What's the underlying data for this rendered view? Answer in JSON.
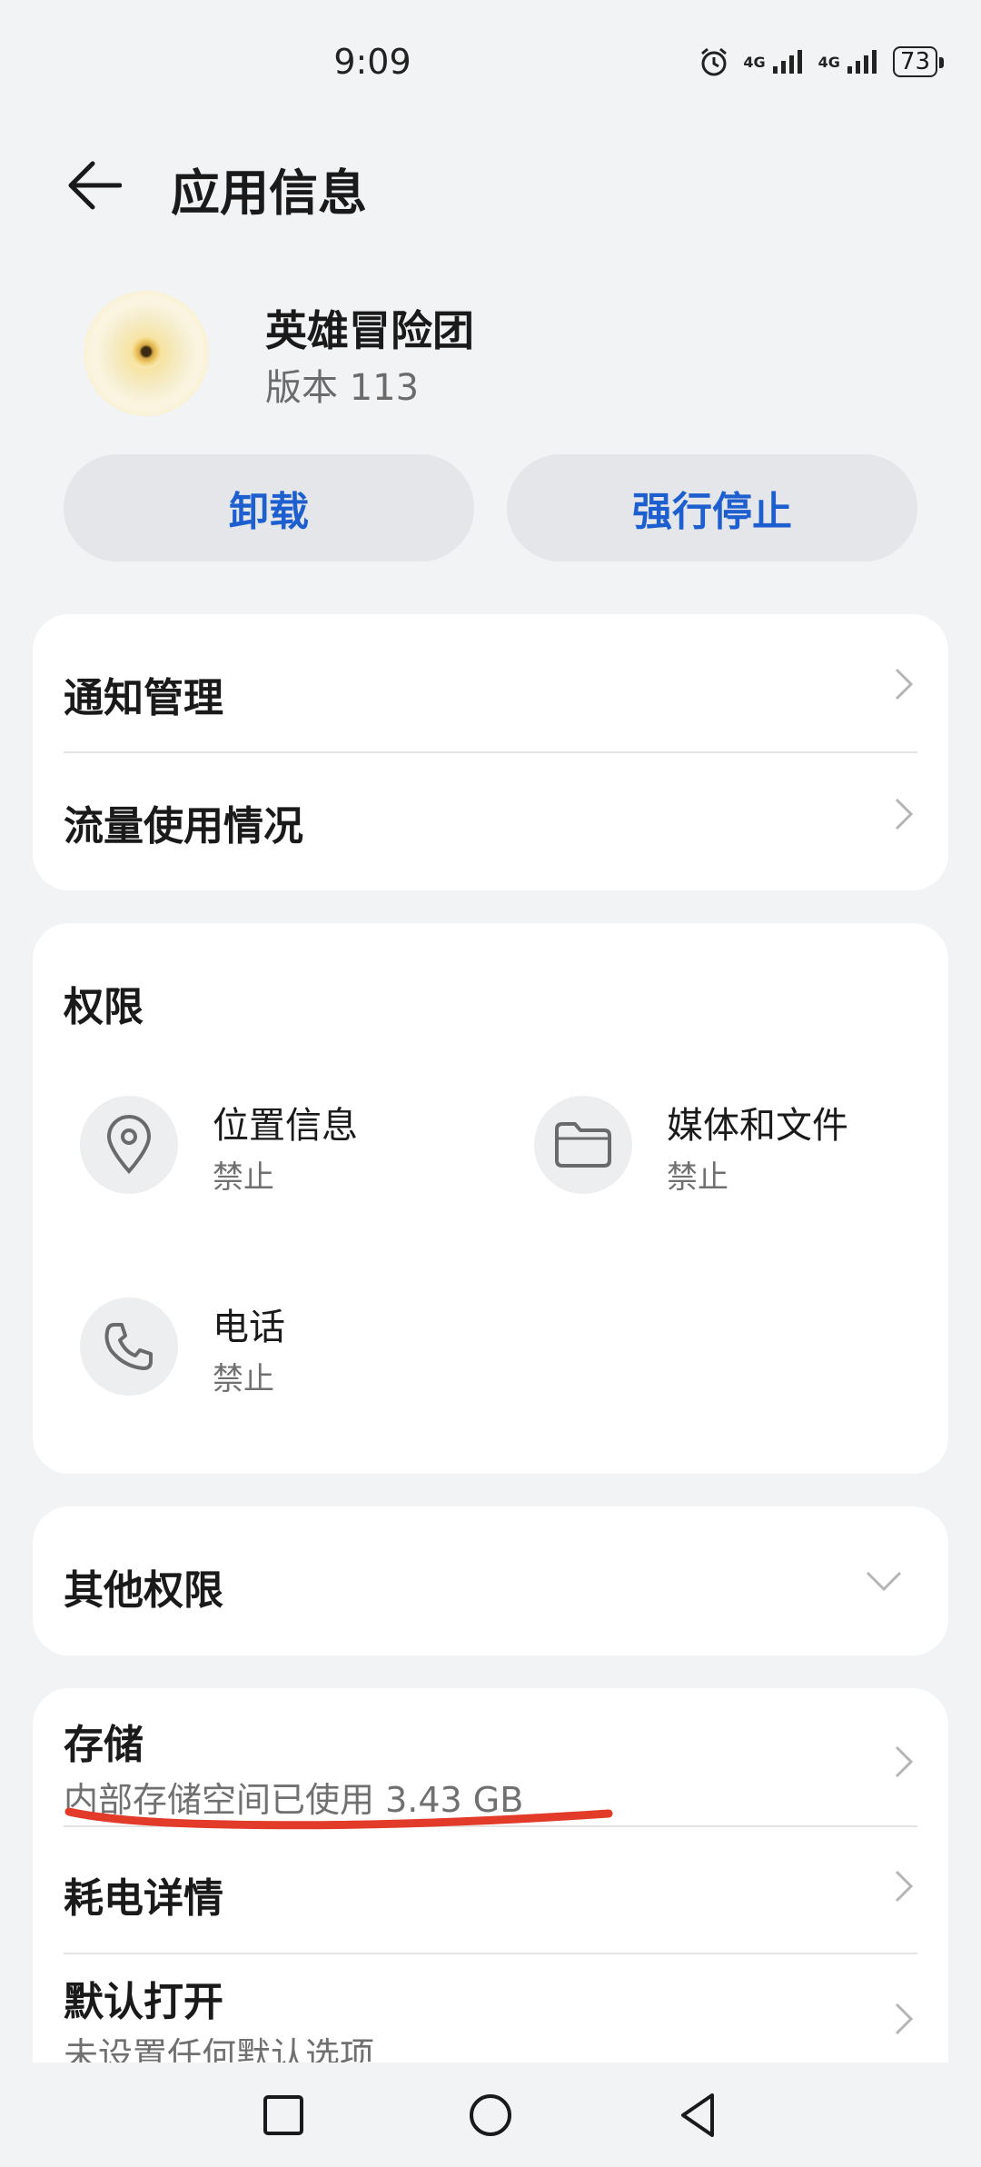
{
  "status": {
    "time": "9:09",
    "battery": "73",
    "signal1": "4G",
    "signal2": "4G",
    "icons": [
      "alarm-icon",
      "signal-icon",
      "signal-icon",
      "battery-icon"
    ]
  },
  "header": {
    "title": "应用信息",
    "back_icon": "back-arrow-icon"
  },
  "app": {
    "name": "英雄冒险团",
    "version": "版本 113"
  },
  "actions": {
    "uninstall": "卸载",
    "force_stop": "强行停止"
  },
  "card1": {
    "notifications": "通知管理",
    "data_usage": "流量使用情况"
  },
  "permissions": {
    "title": "权限",
    "items": [
      {
        "label": "位置信息",
        "status": "禁止",
        "icon": "location-pin-icon"
      },
      {
        "label": "媒体和文件",
        "status": "禁止",
        "icon": "folder-icon"
      },
      {
        "label": "电话",
        "status": "禁止",
        "icon": "phone-icon"
      }
    ]
  },
  "other_permissions": {
    "label": "其他权限",
    "icon": "chevron-down-icon"
  },
  "storage": {
    "label": "存储",
    "detail": "内部存储空间已使用 3.43 GB"
  },
  "battery_details": {
    "label": "耗电详情"
  },
  "default_open": {
    "label": "默认打开",
    "detail": "未设置任何默认选项"
  },
  "colors": {
    "accent": "#1e5fd0",
    "annotation": "#e23b2a",
    "background": "#f1f3f5"
  },
  "nav": {
    "icons": [
      "recents-square-icon",
      "home-circle-icon",
      "back-triangle-icon"
    ]
  }
}
